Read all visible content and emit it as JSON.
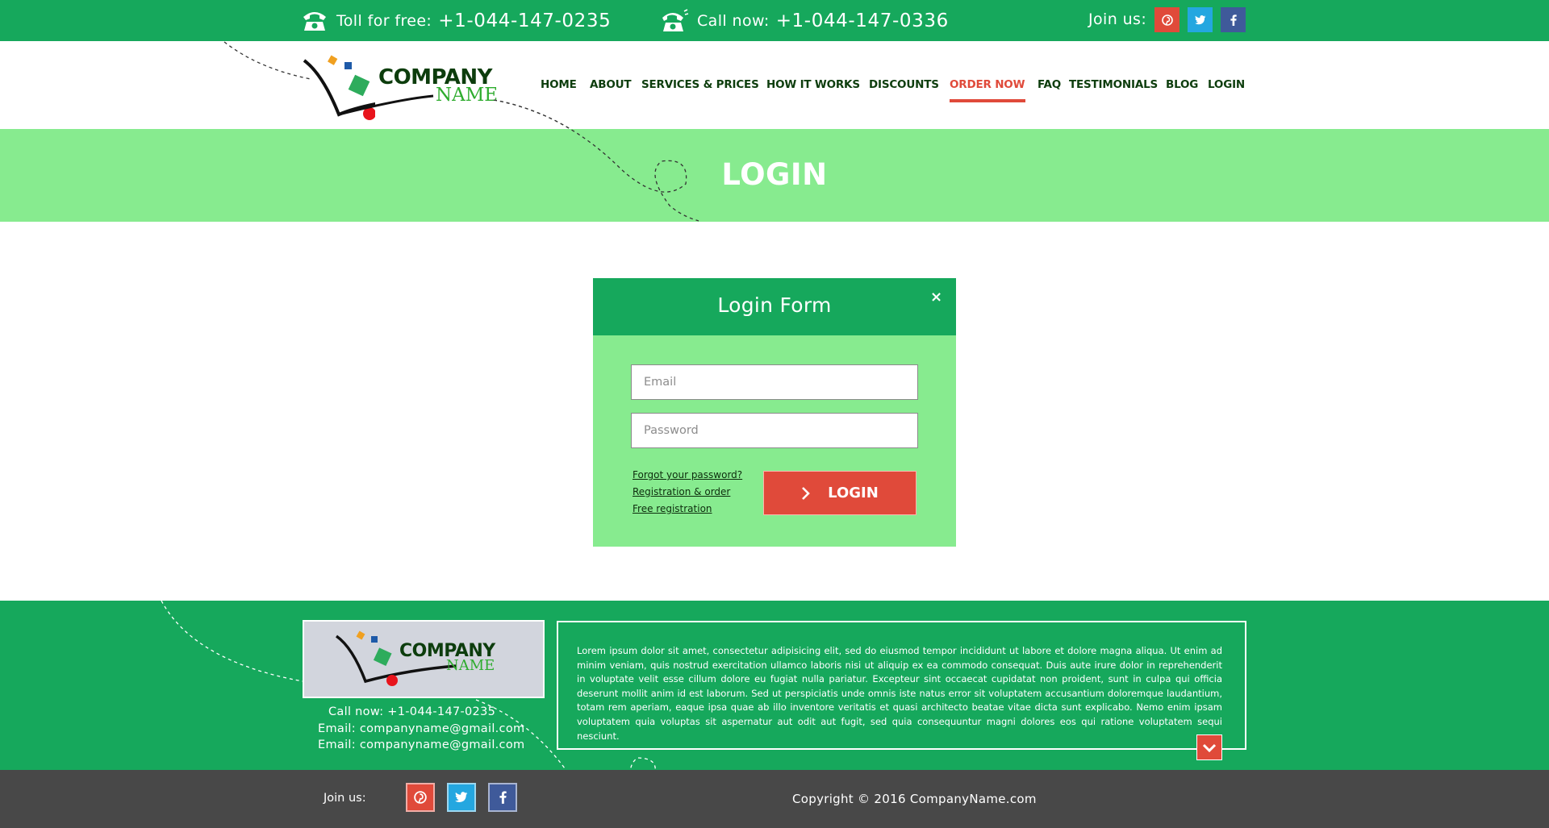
{
  "top_bar": {
    "toll_label": "Toll for free:",
    "toll_number": "+1-044-147-0235",
    "call_label": "Call now:",
    "call_number": "+1-044-147-0336",
    "join_label": "Join us:",
    "social_icons": [
      "pinterest-icon",
      "twitter-icon",
      "facebook-icon"
    ],
    "colors": {
      "background": "#16a85c",
      "pinterest": "#e04a3a",
      "twitter": "#24a7e0",
      "facebook": "#3f5a9a"
    }
  },
  "logo": {
    "line1": "COMPANY",
    "line2": "NAME"
  },
  "nav": {
    "items": [
      "HOME",
      "ABOUT",
      "SERVICES & PRICES",
      "HOW IT WORKS",
      "DISCOUNTS",
      "ORDER NOW",
      "FAQ",
      "TESTIMONIALS",
      "BLOG",
      "LOGIN"
    ],
    "active": "ORDER NOW",
    "colors": {
      "text": "#0d3d0d",
      "active": "#e04a3a"
    }
  },
  "banner": {
    "title": "LOGIN",
    "color": "#87eb8f"
  },
  "login_form": {
    "title": "Login Form",
    "close_symbol": "×",
    "email_placeholder": "Email",
    "password_placeholder": "Password",
    "links": [
      "Forgot your password?",
      "Registration & order",
      "Free registration"
    ],
    "button_label": "LOGIN",
    "button_color": "#e04a3a"
  },
  "footer": {
    "logo": {
      "line1": "COMPANY",
      "line2": "NAME"
    },
    "call": "Call now: +1-044-147-0235",
    "email1": "Email: companyname@gmail.com",
    "email2": "Email: companyname@gmail.com",
    "text": "Lorem ipsum dolor sit amet, consectetur adipisicing elit, sed do eiusmod tempor incididunt ut labore et dolore magna aliqua. Ut enim ad minim veniam, quis nostrud exercitation ullamco laboris nisi ut aliquip ex ea commodo consequat. Duis aute irure dolor in reprehenderit in voluptate velit esse cillum dolore eu fugiat nulla pariatur. Excepteur sint occaecat cupidatat non proident, sunt in culpa qui officia deserunt mollit anim id est laborum. Sed ut perspiciatis unde omnis iste natus error sit voluptatem accusantium doloremque laudantium, totam rem aperiam, eaque ipsa quae ab illo inventore veritatis et quasi architecto beatae vitae dicta sunt explicabo. Nemo enim ipsam voluptatem quia voluptas sit aspernatur aut odit aut fugit, sed quia consequuntur magni dolores eos qui ratione voluptatem sequi nesciunt.",
    "join_label": "Join us:",
    "copyright": "Copyright © 2016 CompanyName.com",
    "colors": {
      "background": "#16a85c",
      "bottom_bar": "#484848"
    }
  }
}
